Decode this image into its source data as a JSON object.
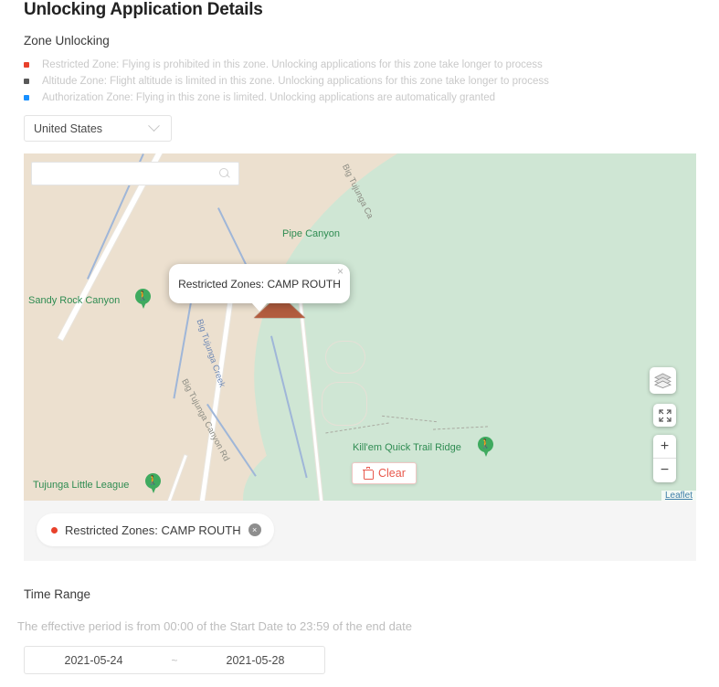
{
  "header": {
    "title": "Unlocking Application Details",
    "section_label": "Zone Unlocking"
  },
  "legend": {
    "items": [
      {
        "color": "#e8412b",
        "text": "Restricted Zone: Flying is prohibited in this zone. Unlocking applications for this zone take longer to process"
      },
      {
        "color": "#595959",
        "text": "Altitude Zone: Flight altitude is limited in this zone. Unlocking applications for this zone take longer to process"
      },
      {
        "color": "#1890ff",
        "text": "Authorization Zone: Flying in this zone is limited. Unlocking applications are automatically granted"
      }
    ]
  },
  "country_select": {
    "value": "United States",
    "icon": "chevron-down-icon"
  },
  "map": {
    "search_placeholder": "",
    "search_value": "",
    "search_icon": "search-icon",
    "popup": {
      "text": "Restricted Zones: CAMP ROUTH",
      "close_label": "×"
    },
    "labels": [
      {
        "name": "Pipe Canyon",
        "type": "place"
      },
      {
        "name": "Sandy Rock Canyon",
        "type": "place"
      },
      {
        "name": "Tujunga Little League",
        "type": "place"
      },
      {
        "name": "Kill'em Quick Trail Ridge",
        "type": "place"
      },
      {
        "name": "Big Tujunga Ca",
        "type": "road"
      },
      {
        "name": "Big Tujunga Canyon Rd",
        "type": "road"
      },
      {
        "name": "Big Tujunga Creek",
        "type": "creek"
      }
    ],
    "controls": {
      "layers_icon": "layers-icon",
      "fullscreen_icon": "fullscreen-expand-icon",
      "zoom_in_label": "+",
      "zoom_out_label": "−"
    },
    "attribution": "Leaflet",
    "clear_button": {
      "label": "Clear",
      "icon": "trash-icon",
      "color": "#e8584c"
    }
  },
  "selected_zones": [
    {
      "label": "Restricted Zones: CAMP ROUTH",
      "dot_color": "#e8412b",
      "remove_label": "×"
    }
  ],
  "time_range": {
    "label": "Time Range",
    "hint": "The effective period is from 00:00 of the Start Date to 23:59 of the end date",
    "start_date": "2021-05-24",
    "separator": "~",
    "end_date": "2021-05-28"
  }
}
